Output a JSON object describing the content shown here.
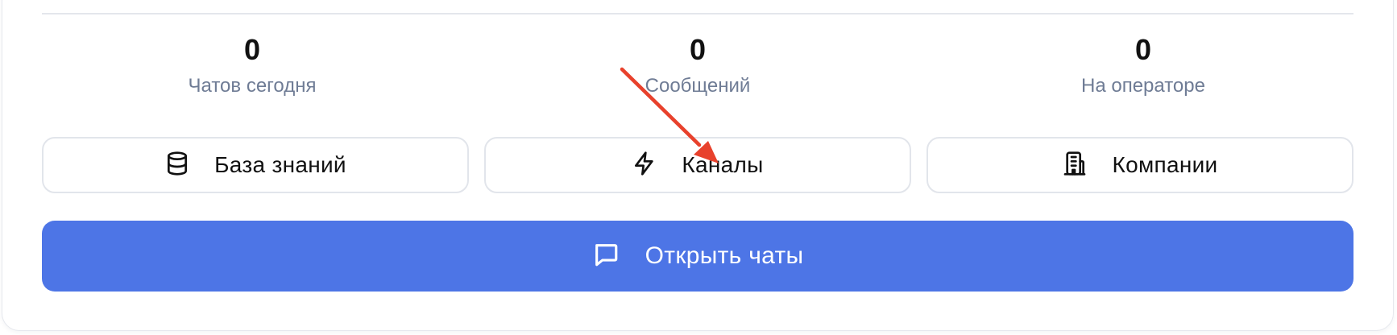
{
  "stats": [
    {
      "value": "0",
      "label": "Чатов сегодня"
    },
    {
      "value": "0",
      "label": "Сообщений"
    },
    {
      "value": "0",
      "label": "На операторе"
    }
  ],
  "actions": {
    "knowledge_base": {
      "label": "База знаний",
      "icon": "database-icon"
    },
    "channels": {
      "label": "Каналы",
      "icon": "lightning-icon"
    },
    "companies": {
      "label": "Компании",
      "icon": "building-icon"
    }
  },
  "primary_action": {
    "label": "Открыть чаты",
    "icon": "chat-bubble-icon"
  },
  "colors": {
    "primary": "#4d75e6",
    "annotation_arrow": "#e8412c",
    "muted_text": "#6f7c95"
  }
}
